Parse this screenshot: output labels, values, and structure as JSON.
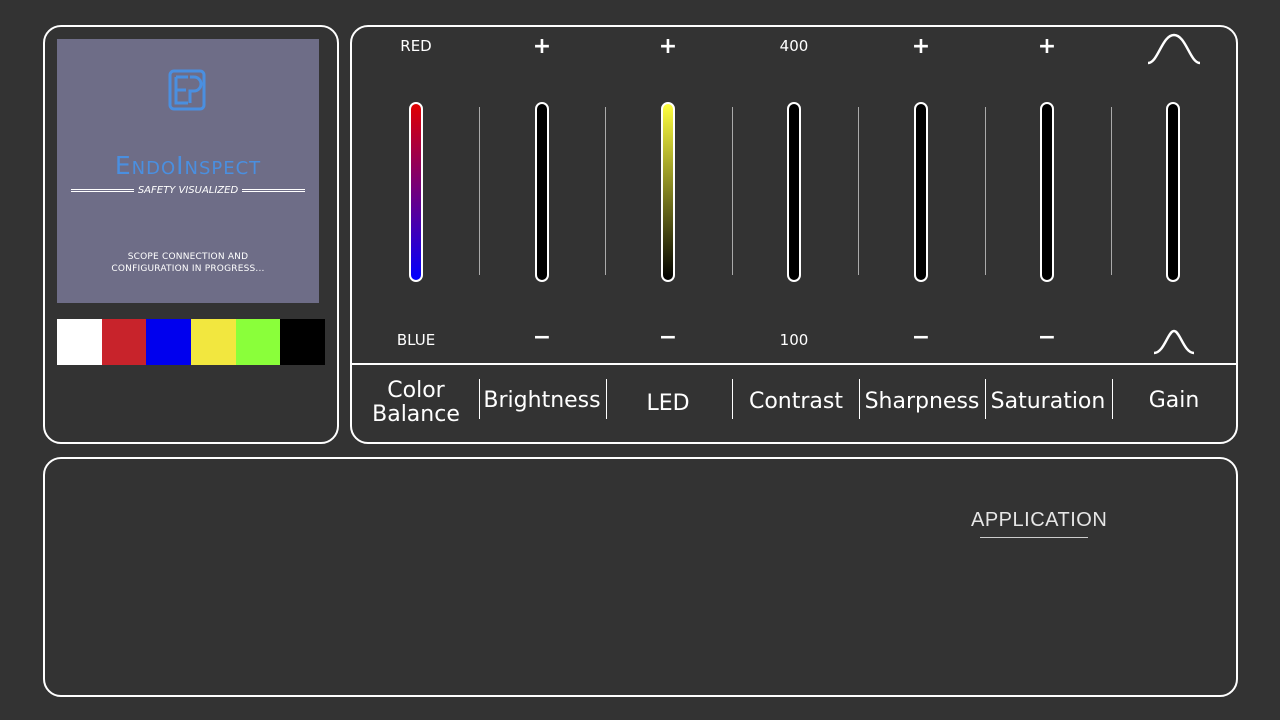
{
  "preview": {
    "brand_name": "EndoInspect",
    "tagline": "SAFETY VISUALIZED",
    "status_line_1": "SCOPE CONNECTION AND",
    "status_line_2": "CONFIGURATION IN PROGRESS...",
    "logo_icon": "endoinspect-logo-icon",
    "screen_color": "#6e6d87",
    "swatches": [
      "#ffffff",
      "#c8232b",
      "#0000ee",
      "#f2e73f",
      "#8aff3a",
      "#000000"
    ]
  },
  "controls": {
    "color_balance": {
      "label": "Color Balance",
      "top": "RED",
      "bottom": "BLUE"
    },
    "brightness": {
      "label": "Brightness",
      "top": "+",
      "bottom": "−"
    },
    "led": {
      "label": "LED",
      "top": "+",
      "bottom": "−"
    },
    "contrast": {
      "label": "Contrast",
      "top": "400",
      "bottom": "100"
    },
    "sharpness": {
      "label": "Sharpness",
      "top": "+",
      "bottom": "−"
    },
    "saturation": {
      "label": "Saturation",
      "top": "+",
      "bottom": "−"
    },
    "gain": {
      "label": "Gain",
      "top_icon": "wide-bell-curve-icon",
      "bottom_icon": "narrow-bell-curve-icon"
    }
  },
  "application": {
    "label": "APPLICATION"
  },
  "colors": {
    "background": "#333333",
    "color_balance_top": "#e00000",
    "color_balance_bottom": "#0000ff",
    "led_top": "#ffff40",
    "led_bottom": "#000000"
  }
}
